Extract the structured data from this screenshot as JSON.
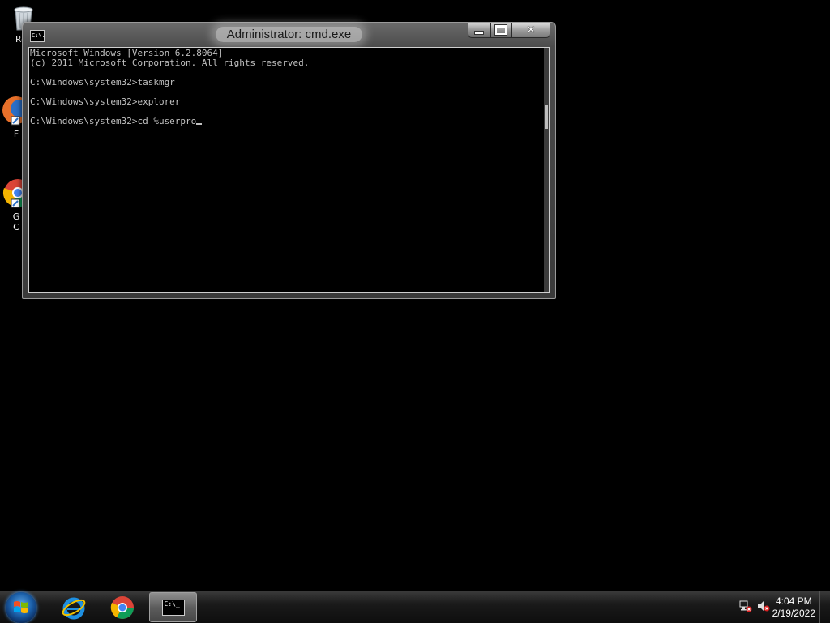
{
  "desktop": {
    "icons": [
      {
        "label": "Rec"
      },
      {
        "label": "F"
      },
      {
        "label": "G"
      },
      {
        "label": "C"
      }
    ]
  },
  "cmd_window": {
    "title": "Administrator: cmd.exe",
    "app_icon_text": "C:\\.",
    "lines": [
      "Microsoft Windows [Version 6.2.8064]",
      "(c) 2011 Microsoft Corporation. All rights reserved.",
      "",
      "C:\\Windows\\system32>taskmgr",
      "",
      "C:\\Windows\\system32>explorer",
      "",
      "C:\\Windows\\system32>cd %userpro"
    ],
    "buttons": {
      "minimize": "minimize",
      "maximize": "maximize",
      "close": "close"
    }
  },
  "taskbar": {
    "start": "start-orb-icon",
    "pinned": [
      {
        "name": "internet-explorer-icon"
      },
      {
        "name": "chrome-icon"
      }
    ],
    "active_cmd_glyph": "C:\\_",
    "clock": {
      "time": "4:04 PM",
      "date": "2/19/2022"
    }
  },
  "colors": {
    "console_bg": "#000000",
    "console_fg": "#c0c0c0"
  }
}
